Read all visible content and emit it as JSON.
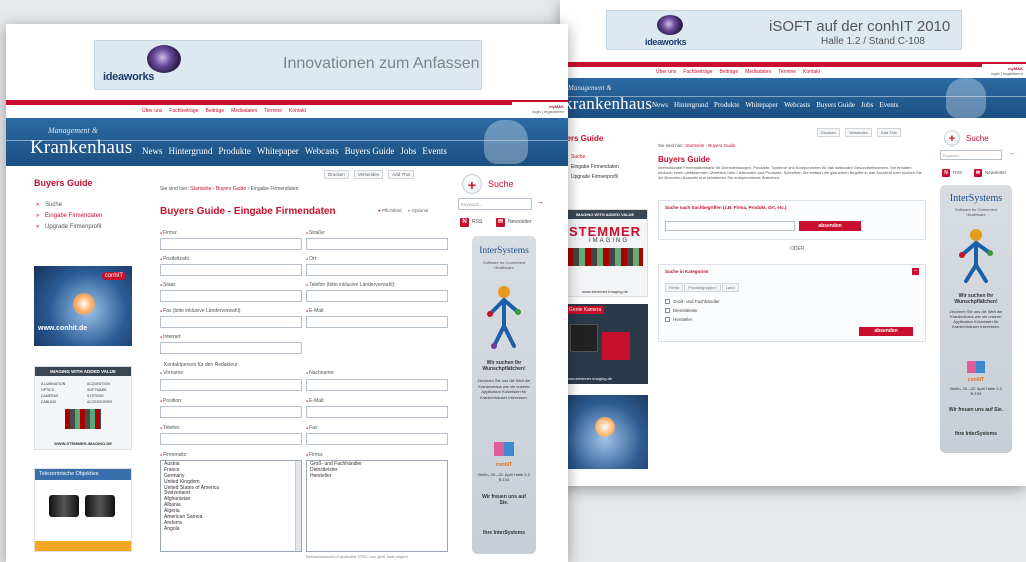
{
  "colors": {
    "accent": "#c8102e",
    "hero": "#1d4f82",
    "banner": "#dde8f1",
    "background": "#e6e8ea"
  },
  "back_window": {
    "banner": {
      "logo": "ideaworks",
      "headline": "iSOFT auf der conhIT 2010",
      "subline": "Halle 1.2 / Stand C-108"
    },
    "top_links": [
      "Über uns",
      "Fachbeiträge",
      "Beiträge",
      "Mediadaten",
      "Termine",
      "Kontakt"
    ],
    "corner": [
      "myM&K",
      "login | registrieren"
    ],
    "brand_small": "Management &",
    "brand_big": "krankenhaus",
    "nav": [
      "News",
      "Hintergrund",
      "Produkte",
      "Whitepaper",
      "Webcasts",
      "Buyers Guide",
      "Jobs",
      "Events"
    ],
    "tools": [
      "Drucken",
      "Versenden",
      "Add This"
    ],
    "sidebar": {
      "title": "yers Guide",
      "items": [
        "Suche",
        "Eingabe Firmendaten",
        "Upgrade Firmenprofil"
      ]
    },
    "breadcrumb": {
      "prefix": "Sie sind hier:",
      "path": [
        "Startseite",
        "Buyers Guide"
      ]
    },
    "page_title": "Buyers Guide",
    "intro": "Internationale Firmendatenbank für Dienstleistungen, Produkte, Systeme und Komponenten für das stationäre Gesundheitswesen. Sie erhalten dadurch einen umfassenden Überblick über Lieferanten und Produkte. Schreiben Sie einfach die gesuchten Begriffe in das Suchfeld oder suchen Sie die Branchen-Auswahl und selektieren Sie entsprechende Branchen.",
    "fulltext": {
      "title": "Suche nach Suchbegriffen (z.B. Firma, Produkt, Ort, etc.)",
      "button": "absenden",
      "or": "ODER"
    },
    "categories": {
      "title": "Suche in Kategorien",
      "tabs": [
        "Firma",
        "Produktgruppen",
        "Land"
      ],
      "options": [
        "Groß- und Fachhändler",
        "Dienstleister",
        "Hersteller"
      ],
      "button": "absenden"
    },
    "search": {
      "label": "Suche",
      "placeholder": "Keyword...",
      "go": "→"
    },
    "feeds": [
      "RSS",
      "Newsletter"
    ],
    "ads": {
      "stemmer_top": "IMAGING WITH ADDED VALUE",
      "stemmer_brand": "STEMMER",
      "stemmer_sub": "IMAGING",
      "stemmer_url": "www.stemmer-imaging.de",
      "camera_title": "Genie Kamera",
      "camera_url": "www.stemmer-imaging.de"
    },
    "sky": {
      "brand": "InterSystems",
      "tagline": "Software for Connected Healthcare",
      "q": "Wir suchen Ihr Wunschpfläfchen!",
      "body": "Zeichnen Sie uns die Welt der Krankenhaus wie sie unserer Applikation Kolonisiert für Krankenhäuser Interessen.",
      "event": "conhIT",
      "event_info": "Berlin, 20.–22. April Halle 2.2 B.103",
      "cta": "Wir freuen uns auf Sie.",
      "footer": "Ihre InterSystems"
    }
  },
  "front_window": {
    "banner": {
      "logo": "ideaworks",
      "headline": "Innovationen zum Anfassen"
    },
    "top_links": [
      "Über uns",
      "Fachbeiträge",
      "Beiträge",
      "Mediadaten",
      "Termine",
      "Kontakt"
    ],
    "corner": [
      "myM&K",
      "login | registrieren"
    ],
    "brand_small": "Management &",
    "brand_big": "Krankenhaus",
    "nav": [
      "News",
      "Hintergrund",
      "Produkte",
      "Whitepaper",
      "Webcasts",
      "Buyers Guide",
      "Jobs",
      "Events"
    ],
    "tools": [
      "Drucken",
      "Versenden",
      "Add This"
    ],
    "sidebar": {
      "title": "Buyers Guide",
      "items": [
        "Suche",
        "Eingabe Firmendaten",
        "Upgrade Firmenprofil"
      ],
      "active": 1
    },
    "breadcrumb": {
      "prefix": "Sie sind hier:",
      "path": [
        "Startseite",
        "Buyers Guide",
        "Eingabe Firmendaten"
      ]
    },
    "page_title": "Buyers Guide - Eingabe Firmendaten",
    "legend": [
      "Pflichtfeld",
      "Optional"
    ],
    "form": {
      "firma": "Firma:",
      "strasse": "Straße:",
      "postleitzahl": "Postleitzahl:",
      "ort": "Ort:",
      "staat": "Staat:",
      "telefon_intl": "Telefon (bitte inklusive Ländervorwahl):",
      "fax_intl": "Fax (bitte inklusive Ländervorwahl):",
      "email": "E-Mail:",
      "internet": "Internet:",
      "contact_heading": "Kontaktperson für den Redakteur",
      "vorname": "Vorname:",
      "nachname": "Nachname:",
      "position": "Position:",
      "email2": "E-Mail:",
      "telefon": "Telefon:",
      "fax": "Fax:",
      "firmensitz": "Firmensitz:",
      "firma2": "Firma:",
      "countries": [
        "Austria",
        "France",
        "Germany",
        "United Kingdom",
        "United States of America",
        "Switzerland",
        "Afghanistan",
        "Albania",
        "Algeria",
        "American Samoa",
        "Andorra",
        "Angola"
      ],
      "company_types": [
        "Groß- und Fachhändler",
        "Dienstleister",
        "Hersteller"
      ],
      "footnote": "Mehrfachauswahl mit gedrückter STRG- bzw. Apfel-Taste möglich"
    },
    "search": {
      "label": "Suche",
      "placeholder": "Keyword...",
      "go": "→"
    },
    "feeds": [
      "RSS",
      "Newsletter"
    ],
    "ads": {
      "event_title": "conhIT",
      "event_url": "www.conhit.de",
      "stemmer_top": "IMAGING WITH ADDED VALUE",
      "stemmer_items": [
        "ILLUMINATION",
        "OPTICS",
        "CAMERAS",
        "CABLING",
        "ACQUISITION",
        "SOFTWARE",
        "SYSTEMS",
        "ACCESSORIES"
      ],
      "stemmer_url": "WWW.STEMMER-IMAGING.DE",
      "optics_title": "Telezentrische Objektive"
    },
    "sky": {
      "brand": "InterSystems",
      "tagline": "Software for Connected Healthcare",
      "q": "Wir suchen Ihr Wunschpfläfchen!",
      "body": "Zeichnen Sie uns die Welt der Krankenhaus wie sie unserer Applikation Kolonisiert für Krankenhäuser Interessen.",
      "event": "conhIT",
      "event_info": "Berlin, 20.–22. April Halle 2.2 B.103",
      "cta": "Wir freuen uns auf Sie.",
      "footer": "Ihre InterSystems"
    }
  }
}
